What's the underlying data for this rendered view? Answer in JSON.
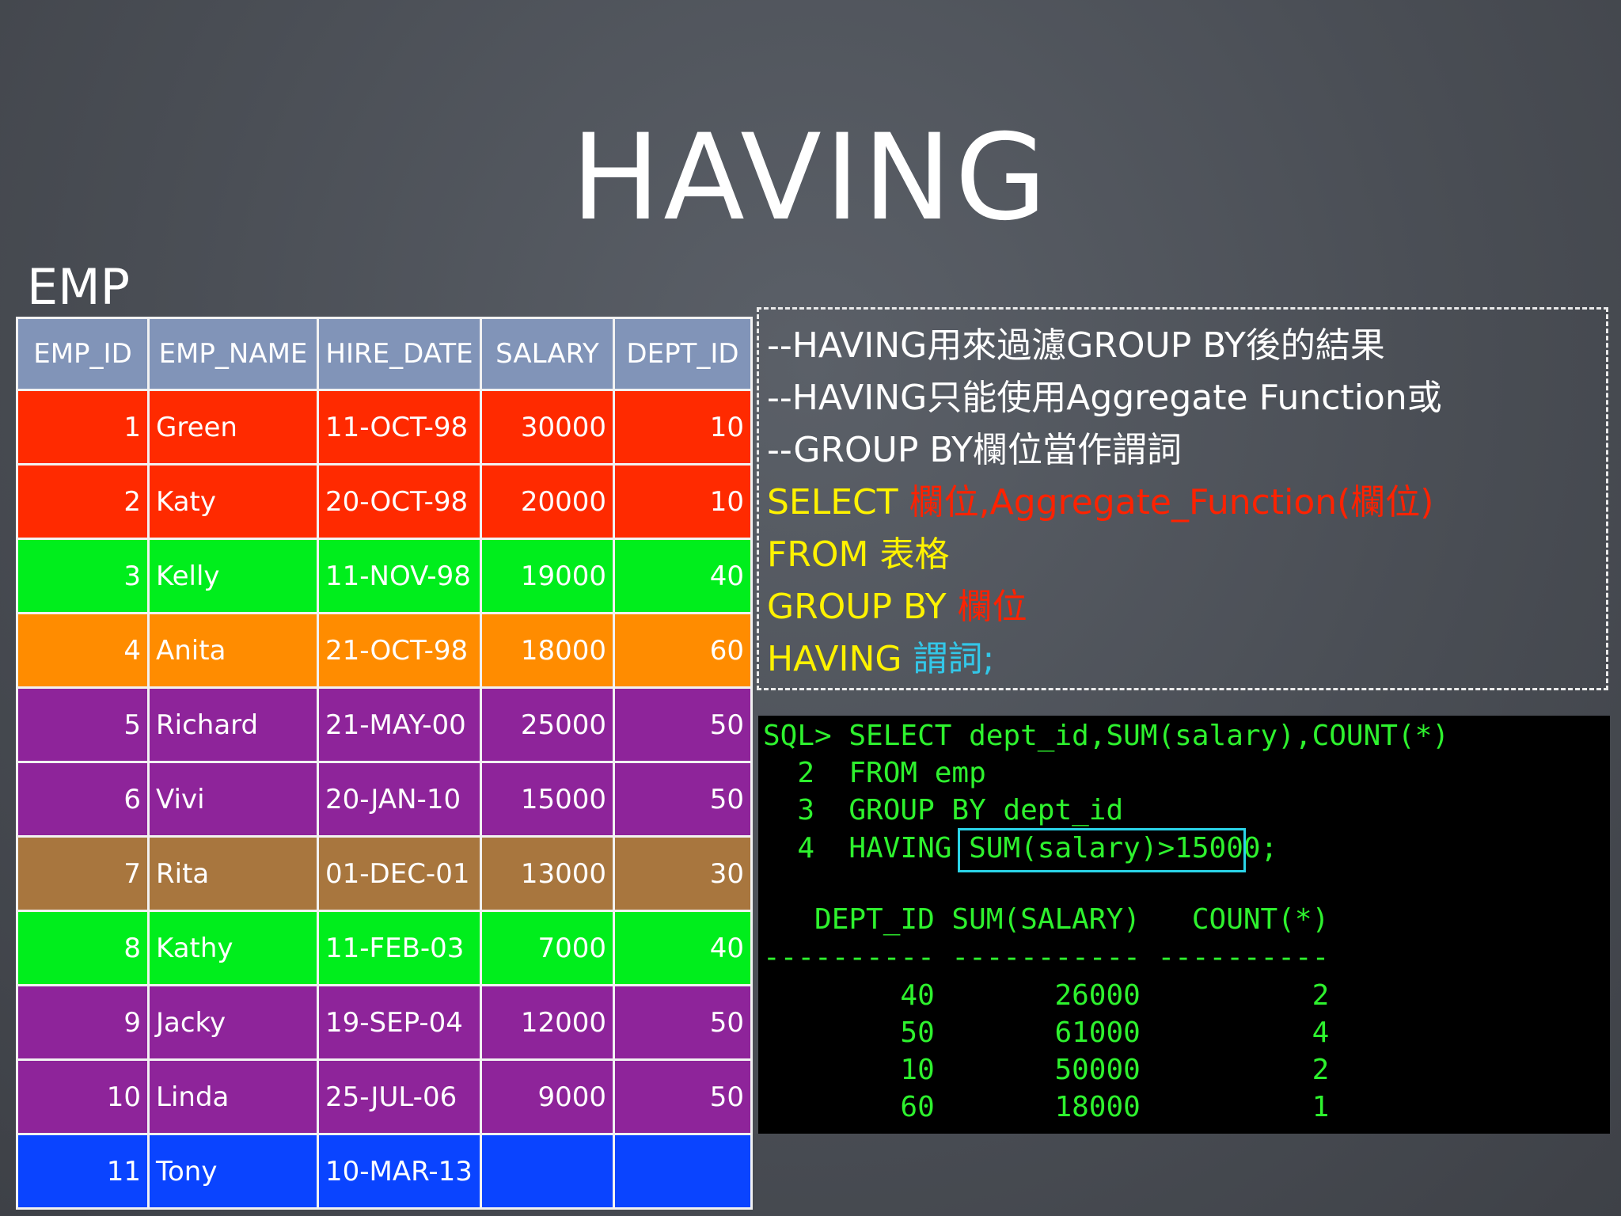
{
  "slide": {
    "title": "HAVING",
    "table_name": "EMP"
  },
  "emp_table": {
    "headers": [
      "EMP_ID",
      "EMP_NAME",
      "HIRE_DATE",
      "SALARY",
      "DEPT_ID"
    ],
    "rows": [
      {
        "emp_id": "1",
        "emp_name": "Green",
        "hire_date": "11-OCT-98",
        "salary": "30000",
        "dept_id": "10",
        "color": "#ff2a00"
      },
      {
        "emp_id": "2",
        "emp_name": "Katy",
        "hire_date": "20-OCT-98",
        "salary": "20000",
        "dept_id": "10",
        "color": "#ff2a00"
      },
      {
        "emp_id": "3",
        "emp_name": "Kelly",
        "hire_date": "11-NOV-98",
        "salary": "19000",
        "dept_id": "40",
        "color": "#00ee1c"
      },
      {
        "emp_id": "4",
        "emp_name": "Anita",
        "hire_date": "21-OCT-98",
        "salary": "18000",
        "dept_id": "60",
        "color": "#ff8c00"
      },
      {
        "emp_id": "5",
        "emp_name": "Richard",
        "hire_date": "21-MAY-00",
        "salary": "25000",
        "dept_id": "50",
        "color": "#8e249a"
      },
      {
        "emp_id": "6",
        "emp_name": "Vivi",
        "hire_date": "20-JAN-10",
        "salary": "15000",
        "dept_id": "50",
        "color": "#8e249a"
      },
      {
        "emp_id": "7",
        "emp_name": "Rita",
        "hire_date": "01-DEC-01",
        "salary": "13000",
        "dept_id": "30",
        "color": "#a8763e"
      },
      {
        "emp_id": "8",
        "emp_name": "Kathy",
        "hire_date": "11-FEB-03",
        "salary": "7000",
        "dept_id": "40",
        "color": "#00ee1c"
      },
      {
        "emp_id": "9",
        "emp_name": "Jacky",
        "hire_date": "19-SEP-04",
        "salary": "12000",
        "dept_id": "50",
        "color": "#8e249a"
      },
      {
        "emp_id": "10",
        "emp_name": "Linda",
        "hire_date": "25-JUL-06",
        "salary": "9000",
        "dept_id": "50",
        "color": "#8e249a"
      },
      {
        "emp_id": "11",
        "emp_name": "Tony",
        "hire_date": "10-MAR-13",
        "salary": "",
        "dept_id": "",
        "color": "#0a44ff"
      }
    ]
  },
  "notes": {
    "comment1_a": "--HAVING",
    "comment1_b": "用來過濾",
    "comment1_c": "GROUP BY",
    "comment1_d": "後的結果",
    "comment2_a": "--HAVING",
    "comment2_b": "只能使用",
    "comment2_c": "Aggregate Function",
    "comment2_d": "或",
    "comment3_a": "--GROUP BY",
    "comment3_b": "欄位當作謂詞",
    "select_kw": "SELECT ",
    "select_cols": "欄位,Aggregate_Function(欄位)",
    "from_kw": "FROM ",
    "from_val": "表格",
    "group_kw": "GROUP BY ",
    "group_val": "欄位",
    "having_kw": "HAVING ",
    "having_val": "謂詞;"
  },
  "terminal": {
    "line1": "SQL> SELECT dept_id,SUM(salary),COUNT(*)",
    "line2": "  2  FROM emp",
    "line3": "  3  GROUP BY dept_id",
    "line4_a": "  4  HAVING ",
    "line4_b": "SUM(salary)>15000",
    "line4_c": ";",
    "header": "   DEPT_ID SUM(SALARY)   COUNT(*)",
    "divider": "---------- ----------- ----------",
    "results": [
      "        40       26000          2",
      "        50       61000          4",
      "        10       50000          2",
      "        60       18000          1"
    ],
    "highlight_color": "#2ad4e8"
  }
}
